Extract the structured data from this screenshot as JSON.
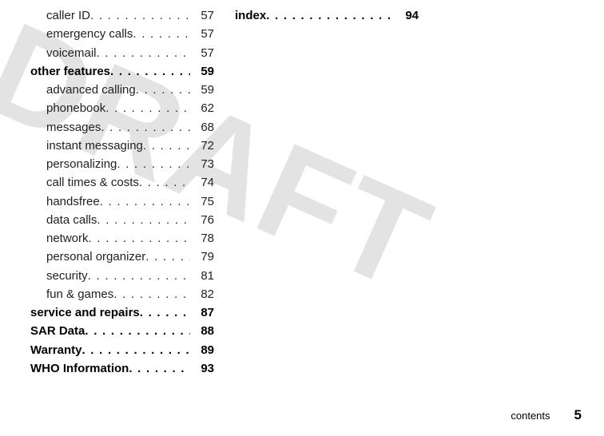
{
  "watermark": "DRAFT",
  "col1": [
    {
      "label": "caller ID",
      "page": "57",
      "indent": true,
      "top": false
    },
    {
      "label": "emergency calls",
      "page": "57",
      "indent": true,
      "top": false
    },
    {
      "label": "voicemail",
      "page": "57",
      "indent": true,
      "top": false
    },
    {
      "label": "other features",
      "page": "59",
      "indent": false,
      "top": true
    },
    {
      "label": "advanced calling",
      "page": "59",
      "indent": true,
      "top": false
    },
    {
      "label": "phonebook",
      "page": "62",
      "indent": true,
      "top": false
    },
    {
      "label": "messages",
      "page": "68",
      "indent": true,
      "top": false
    },
    {
      "label": "instant messaging",
      "page": "72",
      "indent": true,
      "top": false
    },
    {
      "label": "personalizing",
      "page": "73",
      "indent": true,
      "top": false
    },
    {
      "label": "call times & costs",
      "page": "74",
      "indent": true,
      "top": false
    },
    {
      "label": "handsfree",
      "page": "75",
      "indent": true,
      "top": false
    },
    {
      "label": "data calls",
      "page": "76",
      "indent": true,
      "top": false
    },
    {
      "label": "network",
      "page": "78",
      "indent": true,
      "top": false
    },
    {
      "label": "personal organizer",
      "page": "79",
      "indent": true,
      "top": false
    },
    {
      "label": "security",
      "page": "81",
      "indent": true,
      "top": false
    },
    {
      "label": "fun & games",
      "page": "82",
      "indent": true,
      "top": false
    },
    {
      "label": "service and repairs",
      "page": "87",
      "indent": false,
      "top": true
    },
    {
      "label": "SAR Data",
      "page": "88",
      "indent": false,
      "top": true
    },
    {
      "label": "Warranty",
      "page": "89",
      "indent": false,
      "top": true
    },
    {
      "label": "WHO Information",
      "page": "93",
      "indent": false,
      "top": true
    }
  ],
  "col2": [
    {
      "label": "index",
      "page": "94",
      "indent": false,
      "top": true
    }
  ],
  "footer": {
    "section": "contents",
    "page": "5"
  }
}
